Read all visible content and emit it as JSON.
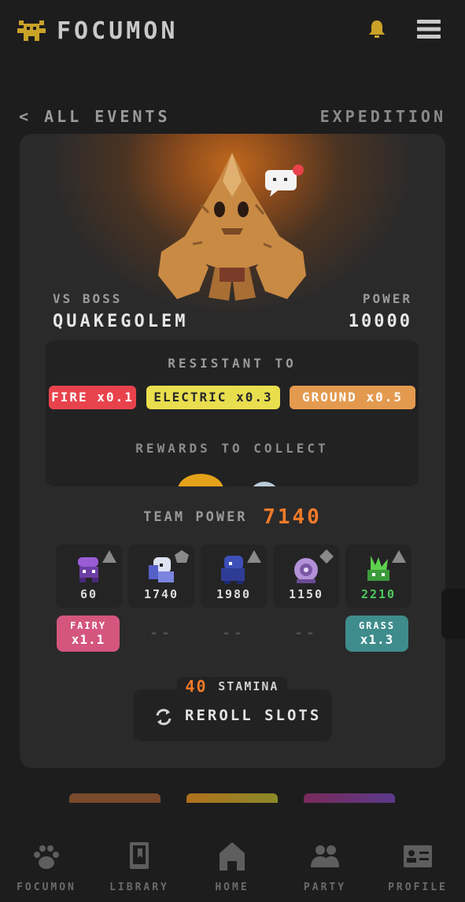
{
  "app": {
    "title": "FOCUMON"
  },
  "subnav": {
    "back_label": "ALL EVENTS",
    "mode_label": "EXPEDITION"
  },
  "boss": {
    "vs_label": "VS BOSS",
    "name": "QUAKEGOLEM",
    "power_label": "POWER",
    "power_value": "10000"
  },
  "resistant": {
    "label": "RESISTANT TO",
    "items": [
      {
        "text": "FIRE x0.1",
        "color": "#e8434c"
      },
      {
        "text": "ELECTRIC x0.3",
        "color": "#e9de4e"
      },
      {
        "text": "GROUND x0.5",
        "color": "#e39a4f"
      }
    ]
  },
  "rewards": {
    "label": "REWARDS TO COLLECT"
  },
  "team": {
    "label": "TEAM POWER",
    "value": "7140"
  },
  "slots": [
    {
      "value": "60",
      "shape": "triangle",
      "badge": {
        "type": "FAIRY",
        "mult": "x1.1",
        "color": "#d4567f"
      }
    },
    {
      "value": "1740",
      "shape": "pentagon",
      "dash": "--"
    },
    {
      "value": "1980",
      "shape": "triangle",
      "dash": "--"
    },
    {
      "value": "1150",
      "shape": "diamond",
      "dash": "--"
    },
    {
      "value": "2210",
      "shape": "triangle",
      "value_color": "#4cc95a",
      "badge": {
        "type": "GRASS",
        "mult": "x1.3",
        "color": "#3f8c8c"
      }
    }
  ],
  "stamina": {
    "value": "40",
    "label": "STAMINA"
  },
  "reroll": {
    "label": "REROLL SLOTS"
  },
  "nav": [
    {
      "label": "FOCUMON",
      "icon": "paw-icon"
    },
    {
      "label": "LIBRARY",
      "icon": "book-icon"
    },
    {
      "label": "HOME",
      "icon": "house-icon"
    },
    {
      "label": "PARTY",
      "icon": "people-icon"
    },
    {
      "label": "PROFILE",
      "icon": "id-card-icon"
    }
  ]
}
